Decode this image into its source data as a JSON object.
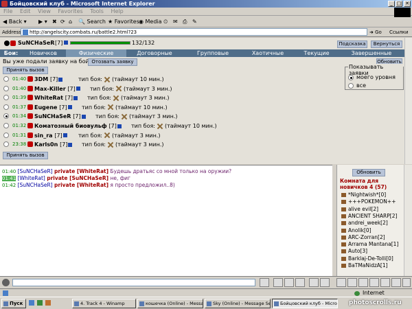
{
  "window": {
    "title": "Бойцовский клуб - Microsoft Internet Explorer",
    "minimize": "_",
    "maximize": "□",
    "close": "✕"
  },
  "menu": [
    "File",
    "Edit",
    "View",
    "Favorites",
    "Tools",
    "Help"
  ],
  "toolbar": {
    "back": "Back",
    "search": "Search",
    "favorites": "Favorites",
    "media": "Media"
  },
  "address": {
    "label": "Address",
    "url": "http://angelscity.combats.ru/battle2.html?23",
    "go": "Go",
    "links": "Ссылки"
  },
  "header": {
    "player": "SuNCHaSeR",
    "level": "[7]",
    "hp": "132/132",
    "hp_fraction": 1.0,
    "hint_button": "Подсказка",
    "return_button": "Вернуться"
  },
  "tabs": {
    "label": "Бои:",
    "items": [
      "Новичков",
      "Физические",
      "Договорные",
      "Групповые",
      "Хаотичные",
      "Текущие",
      "Завершенные"
    ],
    "active_index": 1
  },
  "notice": "Вы уже подали заявку на бой",
  "cancel_button": "Отозвать заявку",
  "refresh_button": "Обновить",
  "accept_button": "Принять вызов",
  "filter": {
    "title": "Показывать заявки",
    "options": [
      "моего уровня",
      "все"
    ],
    "selected": 0
  },
  "fight_type_label": "тип боя:",
  "fights": [
    {
      "time": "01:40",
      "name": "3DM",
      "level": "[7]",
      "timeout": "(таймаут 10 мин.)"
    },
    {
      "time": "01:40",
      "name": "Max-Killer",
      "level": "[7]",
      "timeout": "(таймаут 3 мин.)"
    },
    {
      "time": "01:39",
      "name": "WhiteRat",
      "level": "[7]",
      "timeout": "(таймаут 3 мин.)"
    },
    {
      "time": "01:37",
      "name": "Eugene",
      "level": "[7]",
      "timeout": "(таймаут 10 мин.)"
    },
    {
      "time": "01:34",
      "name": "SuNCHaSeR",
      "level": "[7]",
      "timeout": "(таймаут 3 мин.)"
    },
    {
      "time": "01:32",
      "name": "Коматозный биовульф",
      "level": "[7]",
      "timeout": "(таймаут 10 мин.)"
    },
    {
      "time": "01:31",
      "name": "sin_ra",
      "level": "[7]",
      "timeout": "(таймаут 3 мин.)"
    },
    {
      "time": "23:38",
      "name": "Karls0n",
      "level": "[7]",
      "timeout": "(таймаут 3 мин.)"
    }
  ],
  "selected_fight": 4,
  "chat": [
    {
      "time": "01:40",
      "from": "[SuNCHaSeR]",
      "private": "private [WhiteRat]",
      "text": "Будешь дратьяс со мной только на оружии?"
    },
    {
      "time": "01:41",
      "from": "[WhiteRat]",
      "private": "private [SuNCHaSeR]",
      "text": "не, фиг"
    },
    {
      "time": "01:42",
      "from": "[SuNCHaSeR]",
      "private": "private [WhiteRat]",
      "text": "я просто предложил..8)"
    }
  ],
  "room": {
    "refresh": "Обновить",
    "title": "Комната для новичков 4",
    "count": "(57)",
    "users": [
      "*Nightwish*[0]",
      "+++POKEMON++",
      "alive evil[2]",
      "ANCIENT SHARP[2]",
      "andrei_week[2]",
      "Anolik[0]",
      "ARC-Zorran[2]",
      "Arrama Mantana[1]",
      "Auto[3]",
      "Barklaj-De-Tolli[0]",
      "BaTMaNidzA[1]"
    ]
  },
  "status": {
    "zone": "Internet"
  },
  "taskbar": {
    "start": "Пуск",
    "tasks": [
      "4. Track 4 - Winamp",
      "кошечка (Online) - Messa...",
      "Sky (Online) - Message Se...",
      "Бойцовский клуб - Micro..."
    ],
    "active": 3,
    "clock": "photoscrolls.ru"
  }
}
